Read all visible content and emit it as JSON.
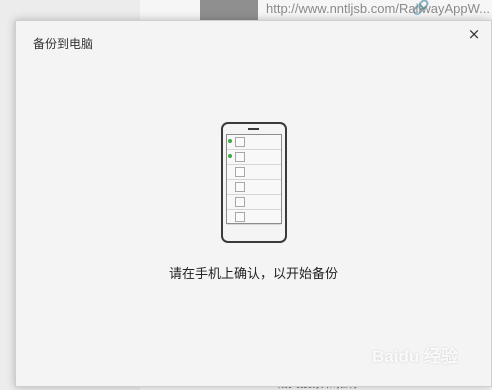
{
  "background": {
    "url_text": "http://www.nntljsb.com/RailwayAppW...",
    "link_glyph": "🔗",
    "bottom_text": "…相关搜索和推荐…",
    "watermark": "Baidu 经验"
  },
  "dialog": {
    "title": "备份到电脑",
    "close_glyph": "×",
    "prompt": "请在手机上确认，以开始备份"
  },
  "phone": {
    "rows": [
      {
        "checked": true
      },
      {
        "checked": true
      },
      {
        "checked": false
      },
      {
        "checked": false
      },
      {
        "checked": false
      },
      {
        "checked": false
      }
    ]
  },
  "colors": {
    "check_dot": "#3ea93e",
    "phone_outline": "#3a3a3a",
    "dialog_bg": "#f4f4f4"
  }
}
